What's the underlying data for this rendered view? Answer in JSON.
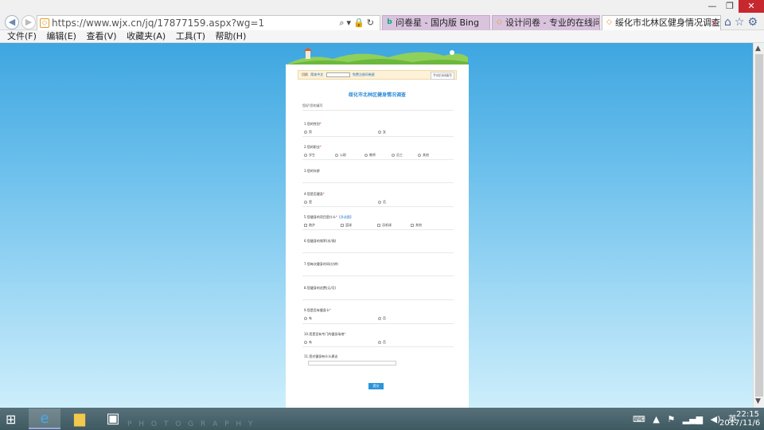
{
  "browser": {
    "address": "https://www.wjx.cn/jq/17877159.aspx?wg=1",
    "tabs": [
      {
        "label": "问卷星 - 国内版 Bing"
      },
      {
        "label": "设计问卷 - 专业的在线问卷..."
      },
      {
        "label": "绥化市北林区健身情况调查"
      }
    ],
    "tab_close": "×",
    "menu": [
      "文件(F)",
      "编辑(E)",
      "查看(V)",
      "收藏夹(A)",
      "工具(T)",
      "帮助(H)"
    ]
  },
  "survey": {
    "title": "绥化市北林区健身情况调查",
    "top_bar": {
      "lang_label": "切换",
      "lang_value": "简体中文",
      "link": "免费注册问卷星",
      "mobile": "手机扫码填写"
    },
    "greeting": "您好!您的填写",
    "questions": [
      {
        "title": "1.您的性别",
        "required": "*",
        "options": [
          "男",
          "女"
        ]
      },
      {
        "title": "2.您的职业",
        "required": "*",
        "options": [
          "学生",
          "公职",
          "教师",
          "员工",
          "其他"
        ]
      },
      {
        "title": "3.您的年龄",
        "required": "",
        "options": []
      },
      {
        "title": "4.您是否健身",
        "required": "*",
        "options": [
          "是",
          "否"
        ]
      },
      {
        "title": "5.您健身的项目是什么",
        "required": "*",
        "extra": "【多选题】",
        "options": [
          "跑步",
          "篮球",
          "羽毛球",
          "其他"
        ]
      },
      {
        "title": "6.您健身的频率(次/周)",
        "required": "",
        "options": []
      },
      {
        "title": "7.您每次健身时间(分钟)",
        "required": "",
        "options": []
      },
      {
        "title": "8.您健身的花费(元/月)",
        "required": "",
        "options": []
      },
      {
        "title": "9.您是否有健身卡",
        "required": "*",
        "options": [
          "有",
          "否"
        ]
      },
      {
        "title": "10.您是否有专门的健身场地",
        "required": "*",
        "options": [
          "有",
          "否"
        ]
      },
      {
        "title": "11.您对健身有什么建议",
        "required": "",
        "options": []
      }
    ],
    "submit": "提交"
  },
  "taskbar": {
    "watermark": "P H O T O G R A P H Y",
    "ime": "英",
    "time": "22:15",
    "date": "2017/11/6"
  },
  "colors": {
    "page_bg": "#6cc0ec",
    "title": "#2a8ad6",
    "submit": "#2a96d9",
    "active_tab_close": "#c04060"
  }
}
